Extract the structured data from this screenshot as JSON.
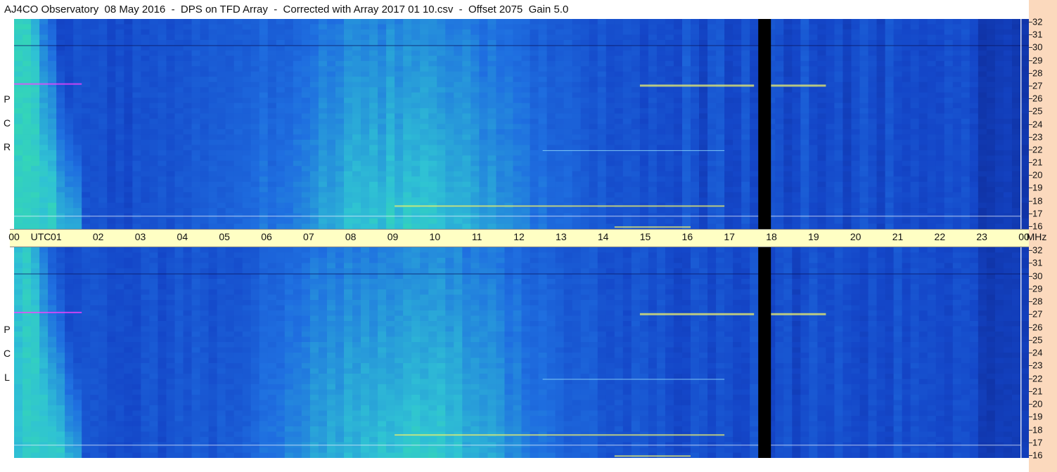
{
  "title": "AJ4CO Observatory  08 May 2016  -  DPS on TFD Array  -  Corrected with Array 2017 01 10.csv  -  Offset 2075  Gain 5.0",
  "chart_data": {
    "type": "heatmap",
    "x_axis": {
      "unit": "UTC",
      "ticks": [
        "00",
        "01",
        "02",
        "03",
        "04",
        "05",
        "06",
        "07",
        "08",
        "09",
        "10",
        "11",
        "12",
        "13",
        "14",
        "15",
        "16",
        "17",
        "18",
        "19",
        "20",
        "21",
        "22",
        "23",
        "00"
      ],
      "first_label_suffix": "UTC"
    },
    "y_axis": {
      "unit": "MHz",
      "ticks": [
        16,
        17,
        18,
        19,
        20,
        21,
        22,
        23,
        24,
        25,
        26,
        27,
        28,
        29,
        30,
        31,
        32
      ],
      "range": [
        16,
        32
      ]
    },
    "panels": [
      {
        "name": "RCP",
        "letters": [
          "P",
          "C",
          "R"
        ]
      },
      {
        "name": "LCP",
        "letters": [
          "P",
          "C",
          "L"
        ]
      }
    ],
    "data_gap_utc": [
      17.6,
      17.9
    ],
    "colors": {
      "background_low": "#0a1a7a",
      "mid": "#1f6fe0",
      "high": "#37e0a8",
      "peak": "#f0f06a",
      "gap": "#000000"
    }
  }
}
